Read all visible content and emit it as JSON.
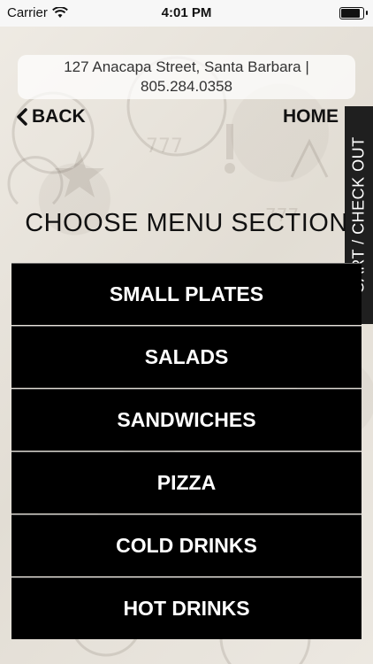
{
  "status_bar": {
    "carrier": "Carrier",
    "time": "4:01 PM",
    "battery_level": 0.9
  },
  "address": {
    "line1": "127 Anacapa Street, Santa Barbara |",
    "line2": "805.284.0358"
  },
  "nav": {
    "back_label": "BACK",
    "home_label": "HOME"
  },
  "cart_tab": {
    "label": "CART / CHECK OUT"
  },
  "page_title": "CHOOSE MENU SECTION",
  "menu_sections": [
    {
      "label": "SMALL PLATES"
    },
    {
      "label": "SALADS"
    },
    {
      "label": "SANDWICHES"
    },
    {
      "label": "PIZZA"
    },
    {
      "label": "COLD DRINKS"
    },
    {
      "label": "HOT DRINKS"
    }
  ],
  "colors": {
    "menu_button_bg": "#000000",
    "menu_button_text": "#ffffff",
    "cart_tab_bg": "#1f1f1f"
  }
}
